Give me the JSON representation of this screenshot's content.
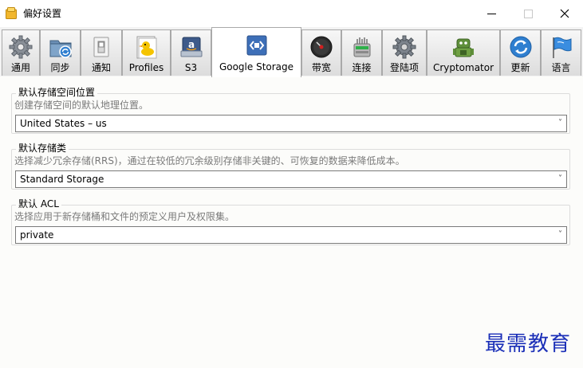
{
  "window": {
    "title": "偏好设置",
    "icon": "app-icon",
    "controls": [
      "minimize-icon",
      "maximize-icon",
      "close-icon"
    ]
  },
  "tabs": [
    {
      "label": "通用",
      "icon": "gear-icon"
    },
    {
      "label": "同步",
      "icon": "sync-folder-icon"
    },
    {
      "label": "通知",
      "icon": "notification-switch-icon"
    },
    {
      "label": "Profiles",
      "icon": "profiles-duck-icon"
    },
    {
      "label": "S3",
      "icon": "amazon-s3-icon"
    },
    {
      "label": "Google Storage",
      "icon": "google-storage-icon",
      "active": true
    },
    {
      "label": "带宽",
      "icon": "bandwidth-gauge-icon"
    },
    {
      "label": "连接",
      "icon": "connection-icon"
    },
    {
      "label": "登陆项",
      "icon": "login-items-gear-icon"
    },
    {
      "label": "Cryptomator",
      "icon": "cryptomator-robot-icon"
    },
    {
      "label": "更新",
      "icon": "update-refresh-icon"
    },
    {
      "label": "语言",
      "icon": "language-flag-icon"
    }
  ],
  "settings": {
    "location": {
      "title": "默认存储空间位置",
      "description": "创建存储空间的默认地理位置。",
      "value": "United States – us"
    },
    "storage_class": {
      "title": "默认存储类",
      "description": "选择减少冗余存储(RRS)，通过在较低的冗余级别存储非关键的、可恢复的数据来降低成本。",
      "value": "Standard Storage"
    },
    "acl": {
      "title": "默认 ACL",
      "description": "选择应用于新存储桶和文件的预定义用户及权限集。",
      "value": "private"
    }
  },
  "watermark": "最需教育",
  "colors": {
    "accent_blue": "#2f7fd0",
    "watermark": "#1b2fb8"
  }
}
